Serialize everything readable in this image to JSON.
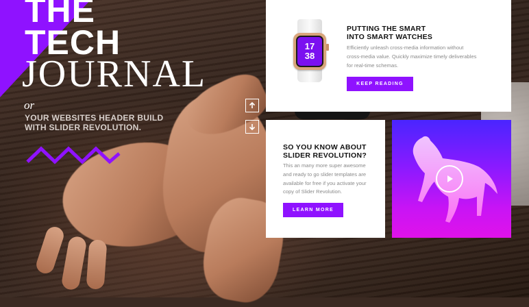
{
  "hero": {
    "title_line1": "THE",
    "title_line2": "TECH",
    "title_line3": "JOURNAL",
    "or_text": "or",
    "subtitle_line1": "YOUR WEBSITES HEADER BUILD",
    "subtitle_line2": "WITH SLIDER REVOLUTION."
  },
  "nav": {
    "up_icon": "arrow-up-icon",
    "down_icon": "arrow-down-icon"
  },
  "card_watch": {
    "heading_line1": "PUTTING THE SMART",
    "heading_line2": "INTO SMART WATCHES",
    "body": "Efficiently unleash cross-media information without cross-media value. Quickly maximize timely deliverables for real-time schemas.",
    "button_label": "KEEP READING",
    "watch_hour": "17",
    "watch_minute": "38"
  },
  "card_slider": {
    "heading_line1": "SO YOU KNOW ABOUT",
    "heading_line2": "SLIDER REVOLUTION?",
    "body": "This an many more super awesome and ready to go slider templates are available for free if you activate your copy of Slider Revolution.",
    "button_label": "LEARN MORE"
  },
  "card_media": {
    "play_icon": "play-icon"
  },
  "colors": {
    "accent": "#8f12ff",
    "card_bg": "#ffffff",
    "media_gradient_top": "#4a25ff",
    "media_gradient_bottom": "#e012ea"
  }
}
